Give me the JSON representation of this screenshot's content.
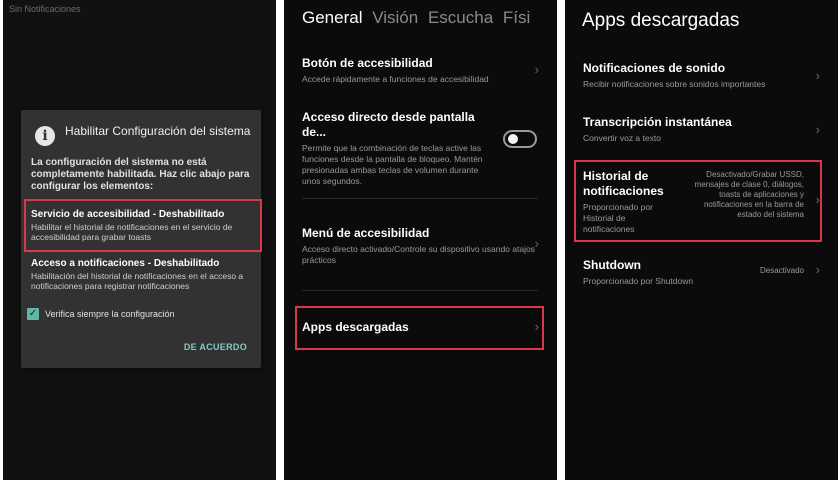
{
  "panel1": {
    "status_text": "Sin Notificaciones",
    "dialog": {
      "icon": "info-icon",
      "title": "Habilitar Configuración del sistema",
      "body": "La configuración del sistema no está completamente habilitada. Haz clic abajo para configurar los elementos:",
      "options": [
        {
          "title": "Servicio de accesibilidad - Deshabilitado",
          "desc": "Habilitar el historial de notificaciones en el servicio de accesibilidad para grabar toasts"
        },
        {
          "title": "Acceso a notificaciones - Deshabilitado",
          "desc": "Habilitación del historial de notificaciones en el acceso a notificaciones para registrar notificaciones"
        }
      ],
      "checkbox_label": "Verifica siempre la configuración",
      "checkbox_checked": true,
      "ok_button": "DE ACUERDO"
    }
  },
  "panel2": {
    "tabs": [
      "General",
      "Visión",
      "Escucha",
      "Físi"
    ],
    "active_tab": "General",
    "items": [
      {
        "title": "Botón de accesibilidad",
        "desc": "Accede rápidamente a funciones de accesibilidad"
      },
      {
        "title": "Acceso directo desde pantalla de...",
        "desc": "Permite que la combinación de teclas active las funciones desde la pantalla de bloqueo. Mantén presionadas ambas teclas de volumen durante unos segundos."
      },
      {
        "title": "Menú de accesibilidad",
        "desc": "Acceso directo activado/Controle su dispositivo usando atajos prácticos"
      },
      {
        "title": "Apps descargadas"
      }
    ],
    "toggle_on": false
  },
  "panel3": {
    "title": "Apps descargadas",
    "items": [
      {
        "title": "Notificaciones de sonido",
        "desc": "Recibir notificaciones sobre sonidos importantes"
      },
      {
        "title": "Transcripción instantánea",
        "desc": "Convertir voz a texto"
      },
      {
        "title": "Historial de notificaciones",
        "desc": "Proporcionado por Historial de notificaciones",
        "value": "Desactivado/Grabar USSD, mensajes de clase 0, diálogos, toasts de aplicaciones y notificaciones en la barra de estado del sistema"
      },
      {
        "title": "Shutdown",
        "desc": "Proporcionado por Shutdown",
        "value": "Desactivado"
      }
    ]
  },
  "colors": {
    "highlight": "#d9384a",
    "accent": "#80cbc4",
    "checkbox": "#60b8a4"
  }
}
